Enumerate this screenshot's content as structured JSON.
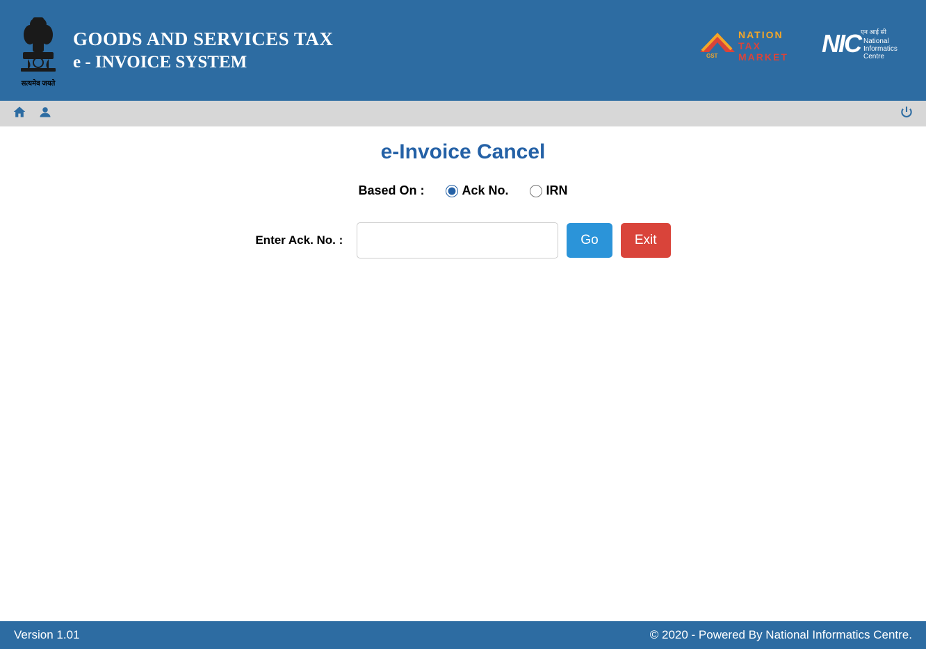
{
  "header": {
    "title_line1": "GOODS AND SERVICES TAX",
    "title_line2": "e - INVOICE SYSTEM",
    "emblem_caption": "सत्यमेव जयते",
    "gst_logo_line1": "NATION",
    "gst_logo_line2": "TAX",
    "gst_logo_line3": "MARKET",
    "gst_logo_badge": "GST",
    "nic_abbrev": "NIC",
    "nic_hindi": "एन आई सी",
    "nic_text1": "National",
    "nic_text2": "Informatics",
    "nic_text3": "Centre"
  },
  "toolbar": {
    "home_icon": "home-icon",
    "user_icon": "user-icon",
    "power_icon": "power-icon"
  },
  "page": {
    "title": "e-Invoice Cancel",
    "based_on_label": "Based On :",
    "option_ack": "Ack No.",
    "option_irn": "IRN",
    "input_label": "Enter Ack. No. :",
    "input_value": "",
    "go_label": "Go",
    "exit_label": "Exit"
  },
  "footer": {
    "version": "Version 1.01",
    "copyright": "© 2020 - Powered By National Informatics Centre."
  }
}
